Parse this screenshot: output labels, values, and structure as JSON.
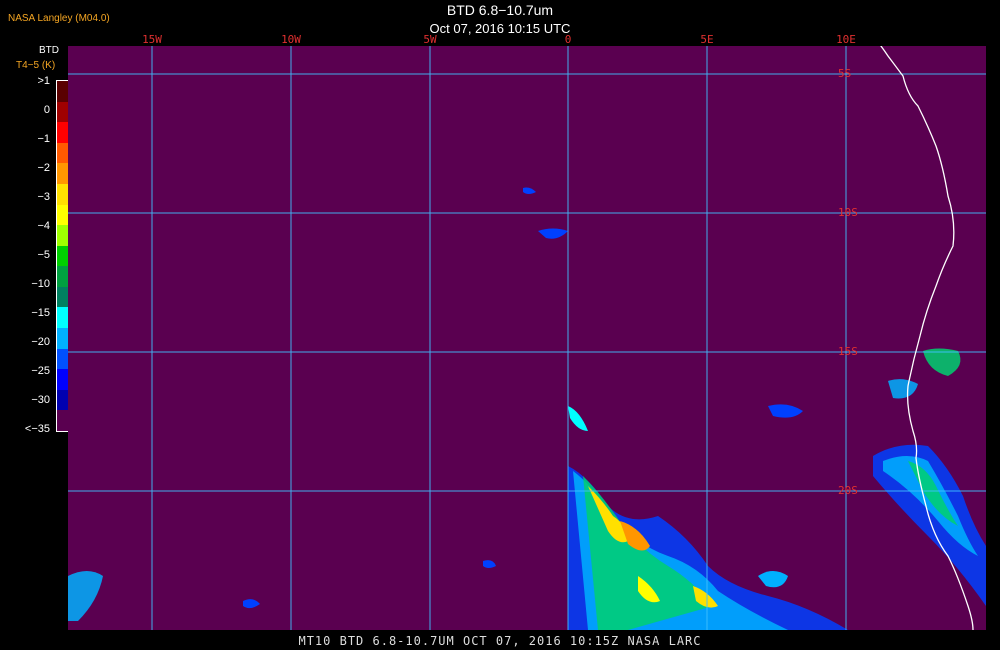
{
  "header": {
    "organization": "NASA Langley (M04.0)",
    "title": "BTD 6.8−10.7um",
    "subtitle": "Oct 07, 2016 10:15 UTC"
  },
  "footer": {
    "caption": "MT10  BTD 6.8-10.7UM   OCT 07, 2016 10:15Z   NASA LARC"
  },
  "colorbar": {
    "title": "BTD",
    "units": "T4−5 (K)",
    "labels": [
      ">1",
      "0",
      "−1",
      "−2",
      "−3",
      "−4",
      "−5",
      "−10",
      "−15",
      "−20",
      "−25",
      "−30",
      "<−35"
    ],
    "colors": [
      "#5a0000",
      "#a00000",
      "#ff0000",
      "#ff5a00",
      "#ff9600",
      "#ffe000",
      "#ffff00",
      "#a0ff00",
      "#00d000",
      "#00a040",
      "#008060",
      "#00ffff",
      "#00b0ff",
      "#0050ff",
      "#0000ff",
      "#0000b0",
      "#5a0050"
    ]
  },
  "axes": {
    "lon_labels": [
      "15W",
      "10W",
      "5W",
      "0",
      "5E",
      "10E"
    ],
    "lat_labels": [
      "5S",
      "10S",
      "15S",
      "20S"
    ]
  },
  "colors": {
    "background": "#5a0050",
    "grid": "#40c0ff",
    "coast": "#ffffff",
    "labels": "#e03030"
  }
}
